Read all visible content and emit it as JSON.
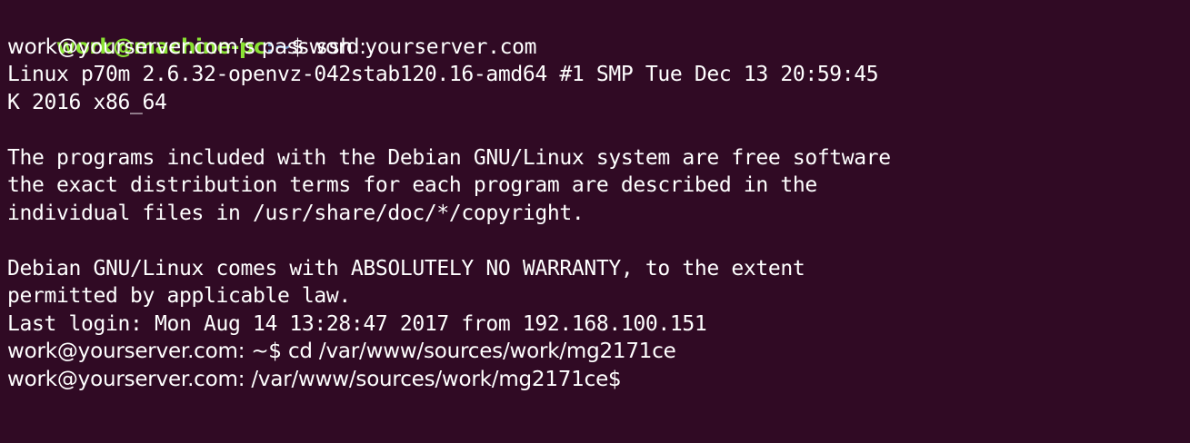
{
  "colors": {
    "background": "#300a24",
    "foreground": "#ffffff",
    "prompt_user_host": "#8ae234",
    "prompt_path": "#729fcf"
  },
  "terminal": {
    "local_prompt": {
      "user_host": "work@machine-pc",
      "separator": ":",
      "path": "~",
      "symbol": "$",
      "command": " ssh yourserver.com"
    },
    "password_prompt": "work@yourserver.com’s password:",
    "output": {
      "uname_line1": "Linux p70m 2.6.32-openvz-042stab120.16-amd64 #1 SMP Tue Dec 13 20:59:45",
      "uname_line2": "K 2016 x86_64",
      "programs_line1": "The programs included with the Debian GNU/Linux system are free software",
      "programs_line2": "the exact distribution terms for each program are described in the",
      "programs_line3": "individual files in /usr/share/doc/*/copyright.",
      "warranty_line1": "Debian GNU/Linux comes with ABSOLUTELY NO WARRANTY, to the extent",
      "warranty_line2": "permitted by applicable law.",
      "last_login": "Last login: Mon Aug 14 13:28:47 2017 from 192.168.100.151"
    },
    "remote_prompt_1": {
      "text": "work@yourserver.com: ~$ cd /var/www/sources/work/mg2171ce"
    },
    "remote_prompt_2": {
      "text": "work@yourserver.com: /var/www/sources/work/mg2171ce$"
    }
  }
}
